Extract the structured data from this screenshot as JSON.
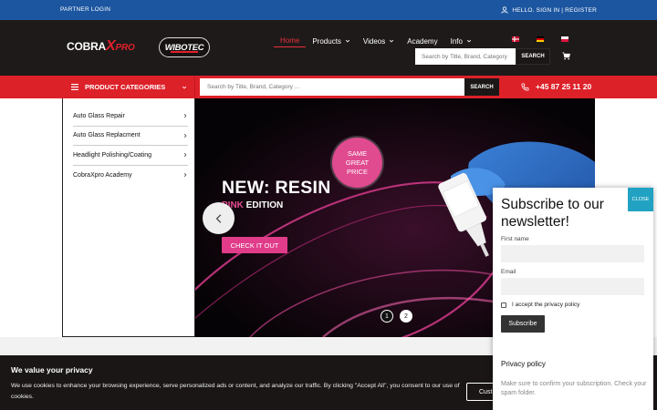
{
  "topbar": {
    "partner_login": "PARTNER LOGIN",
    "hello_text": "HELLO. SIGN IN | REGISTER"
  },
  "logos": {
    "cobra_main": "COBRA",
    "cobra_x": "X",
    "cobra_pro": "PRO",
    "wibotec": "WIBOTEC"
  },
  "nav": {
    "items": [
      {
        "label": "Home",
        "active": true,
        "dropdown": false
      },
      {
        "label": "Products",
        "active": false,
        "dropdown": true
      },
      {
        "label": "Videos",
        "active": false,
        "dropdown": true
      },
      {
        "label": "Academy",
        "active": false,
        "dropdown": false
      },
      {
        "label": "Info",
        "active": false,
        "dropdown": true
      }
    ],
    "flags": [
      "flag-dk-icon",
      "flag-de-icon",
      "flag-pl-icon"
    ]
  },
  "header_search": {
    "placeholder": "Search by Title, Brand, Category ...",
    "button": "SEARCH"
  },
  "categories": {
    "button_label": "PRODUCT CATEGORIES",
    "items": [
      "Auto Glass Repair",
      "Auto Glass Replacment",
      "Headlight Polishing/Coating",
      "CobraXpro Academy"
    ]
  },
  "main_search": {
    "placeholder": "Search by Title, Brand, Category ...",
    "button": "SEARCH"
  },
  "phone": "+45 87 25 11 20",
  "hero": {
    "title": "NEW: RESIN",
    "subtitle_pink": "PINK",
    "subtitle_rest": " EDITION",
    "cta": "CHECK IT OUT",
    "badge": [
      "SAME",
      "GREAT",
      "PRICE"
    ],
    "dots": [
      "1",
      "2"
    ]
  },
  "cookie": {
    "title": "We value your privacy",
    "text": "We use cookies to enhance your browsing experience, serve personalized ads or content, and analyze our traffic. By clicking \"Accept All\", you consent to our use of cookies.",
    "customize": "Cust"
  },
  "newsletter": {
    "close": "CLOSE",
    "title": "Subscribe to our newsletter!",
    "first_name_label": "First name",
    "email_label": "Email",
    "privacy_accept": "I accept the privacy policy",
    "subscribe": "Subscribe",
    "privacy_title": "Privacy policy",
    "privacy_note": "Make sure to confirm your subscription. Check your spam folder."
  },
  "colors": {
    "topbar_blue": "#1c56a0",
    "header_dark": "#1e1a1a",
    "brand_red": "#dd2129",
    "hero_pink": "#e03c8a",
    "close_teal": "#21a2c2"
  }
}
